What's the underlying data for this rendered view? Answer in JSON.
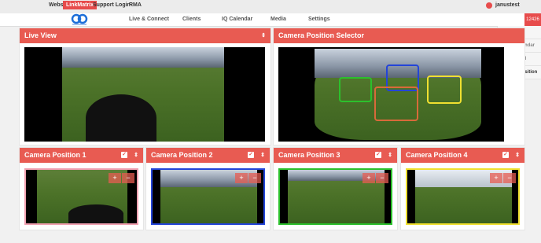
{
  "topbar": {
    "links": [
      "Website",
      "LinkMatrix",
      "Support Login",
      "RMA"
    ],
    "active": "LinkMatrix",
    "user": "janustest"
  },
  "nav": [
    "Live & Connect",
    "Clients",
    "IQ Calendar",
    "Media",
    "Settings"
  ],
  "id_badge": "12426",
  "menu": [
    "12426",
    "Client Calendar",
    "Scoreboard",
    "Camera Position"
  ],
  "menu_selected": "Camera Position",
  "panels": {
    "live_view": "Live View",
    "selector": "Camera Position Selector"
  },
  "cameras": [
    {
      "title": "Camera Position 1",
      "color": "#f0a0b0"
    },
    {
      "title": "Camera Position 2",
      "color": "#2445d8"
    },
    {
      "title": "Camera Position 3",
      "color": "#2cc02c"
    },
    {
      "title": "Camera Position 4",
      "color": "#f0e030"
    }
  ],
  "icons": {
    "zoom_in": "+",
    "zoom_out": "−",
    "check": "✓",
    "arrows": "⇕"
  },
  "colors": {
    "accent": "#e85b52",
    "rect_red": "#d86a3a"
  }
}
